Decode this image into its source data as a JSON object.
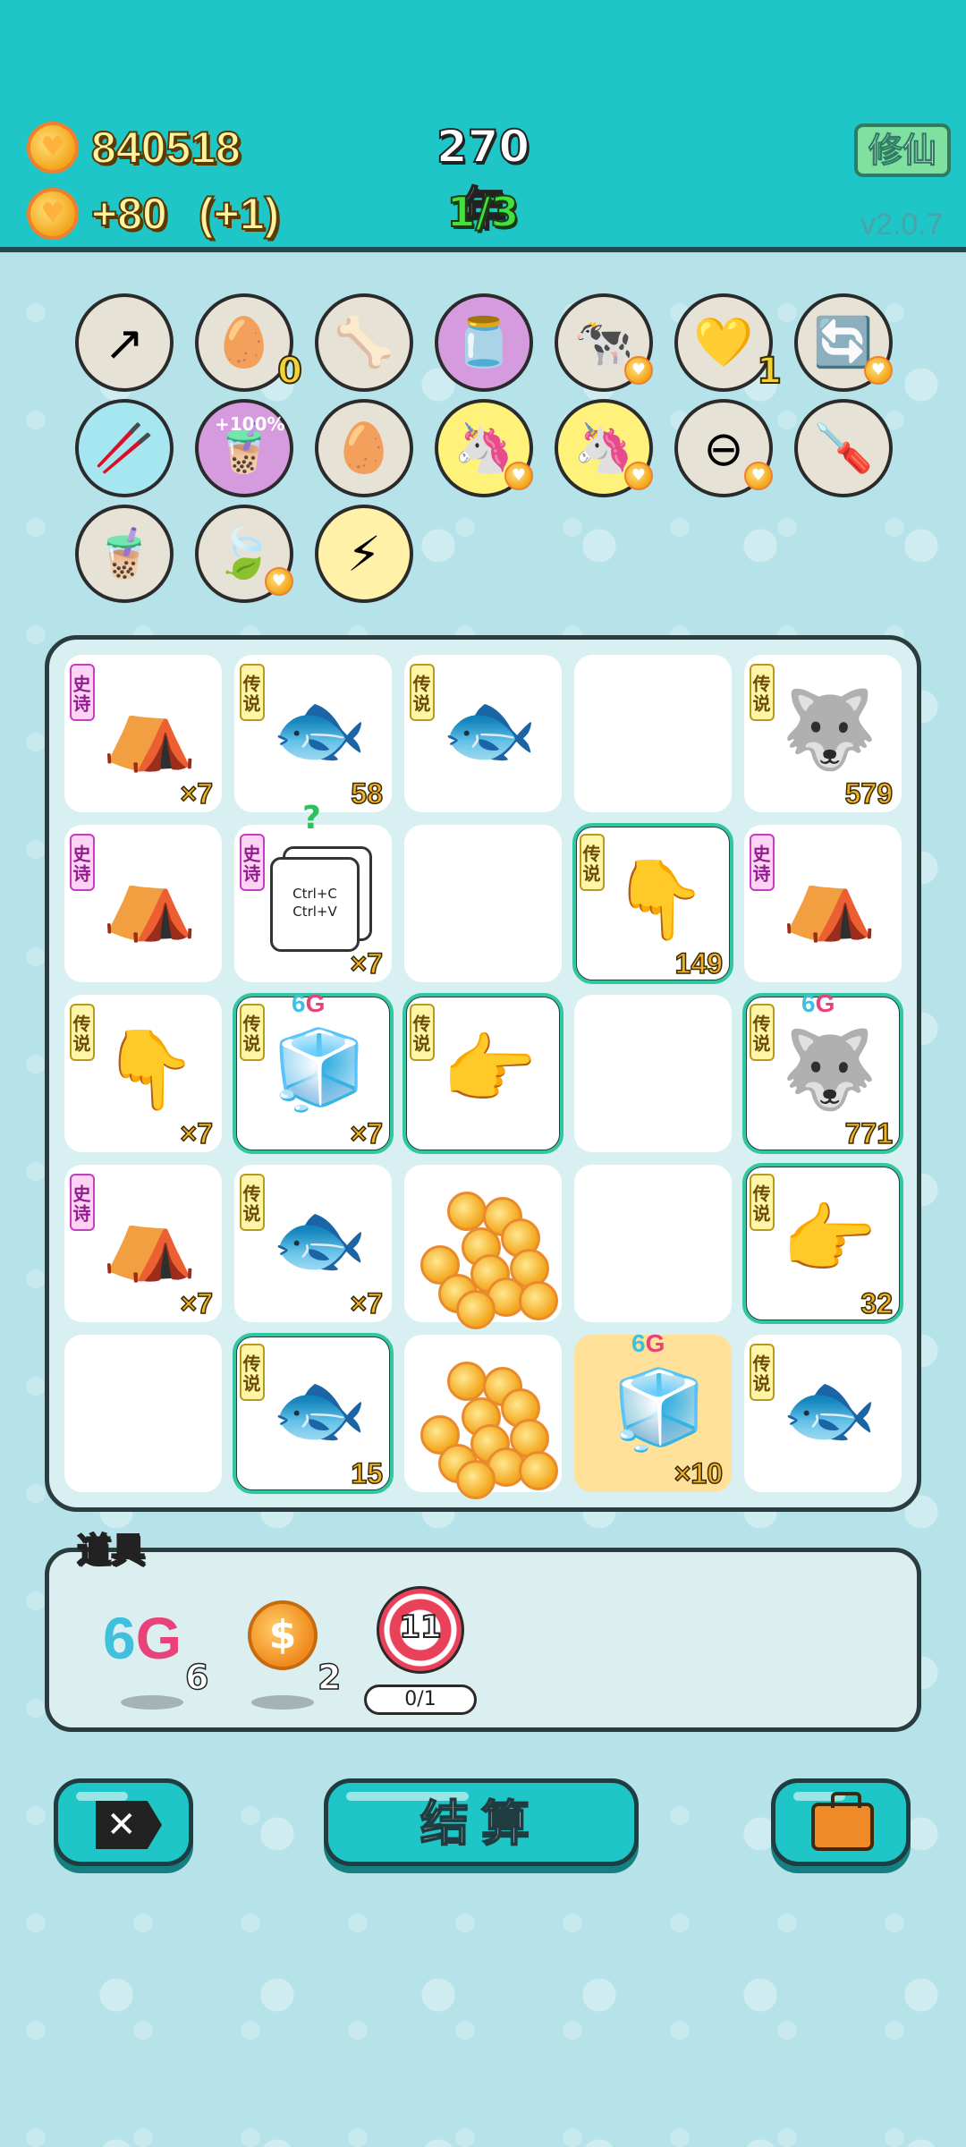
{
  "header": {
    "coins_total": "840518",
    "coins_income": "+80",
    "income_bonus": "(+1)",
    "year": "270年",
    "round": "1/3",
    "mode_button": "修仙",
    "version": "v2.0.7"
  },
  "relics": [
    {
      "name": "arrow-up-icon",
      "glyph": "↗",
      "badge": "",
      "count": ""
    },
    {
      "name": "egg-tray-icon",
      "glyph": "🥚",
      "badge": "",
      "count": "0"
    },
    {
      "name": "pet-food-icon",
      "glyph": "🦴",
      "badge": "",
      "count": ""
    },
    {
      "name": "milk-jar-icon",
      "glyph": "🫙",
      "badge": "",
      "count": ""
    },
    {
      "name": "cow-pair-icon",
      "glyph": "🐄",
      "badge": "♥",
      "count": ""
    },
    {
      "name": "heart-card-icon",
      "glyph": "💛",
      "badge": "",
      "count": "1"
    },
    {
      "name": "refresh-icon",
      "glyph": "🔄",
      "badge": "♥",
      "count": ""
    },
    {
      "name": "chopsticks-icon",
      "glyph": "🥢",
      "badge": "",
      "count": ""
    },
    {
      "name": "bubble-tea-icon",
      "glyph": "🧋",
      "badge": "",
      "count": "+100%"
    },
    {
      "name": "egg-icon",
      "glyph": "🥚",
      "badge": "",
      "count": ""
    },
    {
      "name": "unicorn-icon",
      "glyph": "🦄",
      "badge": "♥",
      "count": ""
    },
    {
      "name": "unicorn-icon",
      "glyph": "🦄",
      "badge": "♥",
      "count": ""
    },
    {
      "name": "minus-circle-icon",
      "glyph": "⊖",
      "badge": "♥",
      "count": ""
    },
    {
      "name": "screwdriver-icon",
      "glyph": "🪛",
      "badge": "",
      "count": ""
    },
    {
      "name": "milk-tea-icon",
      "glyph": "🧋",
      "badge": "",
      "count": ""
    },
    {
      "name": "leaf-icon",
      "glyph": "🍃",
      "badge": "♥",
      "count": ""
    },
    {
      "name": "lightning-icon",
      "glyph": "⚡",
      "badge": "",
      "count": ""
    }
  ],
  "board": {
    "tags": {
      "legend": "传说",
      "epic": "史诗"
    },
    "cells": [
      {
        "name": "bunny-tent",
        "tag": "epic",
        "glyph": "⛺",
        "count": "×7",
        "six_g": false,
        "highlight": false
      },
      {
        "name": "koi-fish",
        "tag": "legend",
        "glyph": "🐟",
        "count": "58",
        "six_g": false,
        "highlight": false
      },
      {
        "name": "koi-fish",
        "tag": "legend",
        "glyph": "🐟",
        "count": "",
        "six_g": false,
        "highlight": false
      },
      {
        "name": "empty",
        "tag": "",
        "glyph": "",
        "count": "",
        "six_g": false,
        "highlight": false
      },
      {
        "name": "husky-king",
        "tag": "legend",
        "glyph": "🐺",
        "count": "579",
        "six_g": false,
        "highlight": false
      },
      {
        "name": "bunny-tent",
        "tag": "epic",
        "glyph": "⛺",
        "count": "",
        "six_g": false,
        "highlight": false
      },
      {
        "name": "copy-paste",
        "tag": "epic",
        "glyph": "",
        "count": "×7",
        "six_g": false,
        "highlight": false
      },
      {
        "name": "empty",
        "tag": "",
        "glyph": "",
        "count": "",
        "six_g": false,
        "highlight": false
      },
      {
        "name": "pointing-hand",
        "tag": "legend",
        "glyph": "👇",
        "count": "149",
        "six_g": false,
        "highlight": true
      },
      {
        "name": "bunny-tent",
        "tag": "epic",
        "glyph": "⛺",
        "count": "",
        "six_g": false,
        "highlight": false
      },
      {
        "name": "pointing-hand",
        "tag": "legend",
        "glyph": "👇",
        "count": "×7",
        "six_g": false,
        "highlight": false
      },
      {
        "name": "fridge",
        "tag": "legend",
        "glyph": "🧊",
        "count": "×7",
        "six_g": true,
        "highlight": true
      },
      {
        "name": "pointing-hand",
        "tag": "legend",
        "glyph": "👉",
        "count": "",
        "six_g": false,
        "highlight": true
      },
      {
        "name": "empty",
        "tag": "",
        "glyph": "",
        "count": "",
        "six_g": false,
        "highlight": false
      },
      {
        "name": "husky-king",
        "tag": "legend",
        "glyph": "🐺",
        "count": "771",
        "six_g": true,
        "highlight": true
      },
      {
        "name": "bunny-tent",
        "tag": "epic",
        "glyph": "⛺",
        "count": "×7",
        "six_g": false,
        "highlight": false
      },
      {
        "name": "koi-fish",
        "tag": "legend",
        "glyph": "🐟",
        "count": "×7",
        "six_g": false,
        "highlight": false
      },
      {
        "name": "coin-pile",
        "tag": "",
        "glyph": "",
        "count": "",
        "six_g": false,
        "highlight": false
      },
      {
        "name": "empty",
        "tag": "",
        "glyph": "",
        "count": "",
        "six_g": false,
        "highlight": false
      },
      {
        "name": "pointing-hand",
        "tag": "legend",
        "glyph": "👉",
        "count": "32",
        "six_g": false,
        "highlight": true
      },
      {
        "name": "empty",
        "tag": "",
        "glyph": "",
        "count": "",
        "six_g": false,
        "highlight": false
      },
      {
        "name": "koi-fish",
        "tag": "legend",
        "glyph": "🐟",
        "count": "15",
        "six_g": false,
        "highlight": true
      },
      {
        "name": "coin-pile",
        "tag": "",
        "glyph": "",
        "count": "",
        "six_g": false,
        "highlight": false
      },
      {
        "name": "fridge",
        "tag": "",
        "glyph": "🧊",
        "count": "×10",
        "six_g": true,
        "highlight": false,
        "selected": true
      },
      {
        "name": "koi-fish",
        "tag": "legend",
        "glyph": "🐟",
        "count": "",
        "six_g": false,
        "highlight": false
      }
    ],
    "six_g_text": {
      "six": "6",
      "g": "G"
    },
    "copy_paste": {
      "line1": "Ctrl+C",
      "line2": "Ctrl+V",
      "mark": "?"
    }
  },
  "props": {
    "title": "道具",
    "six_g": {
      "six": "6",
      "g": "G",
      "count": "6"
    },
    "coin": {
      "glyph": "$",
      "count": "2"
    },
    "target": {
      "value": "11",
      "progress": "0/1"
    }
  },
  "buttons": {
    "exit": "✕",
    "settle": "结算"
  }
}
